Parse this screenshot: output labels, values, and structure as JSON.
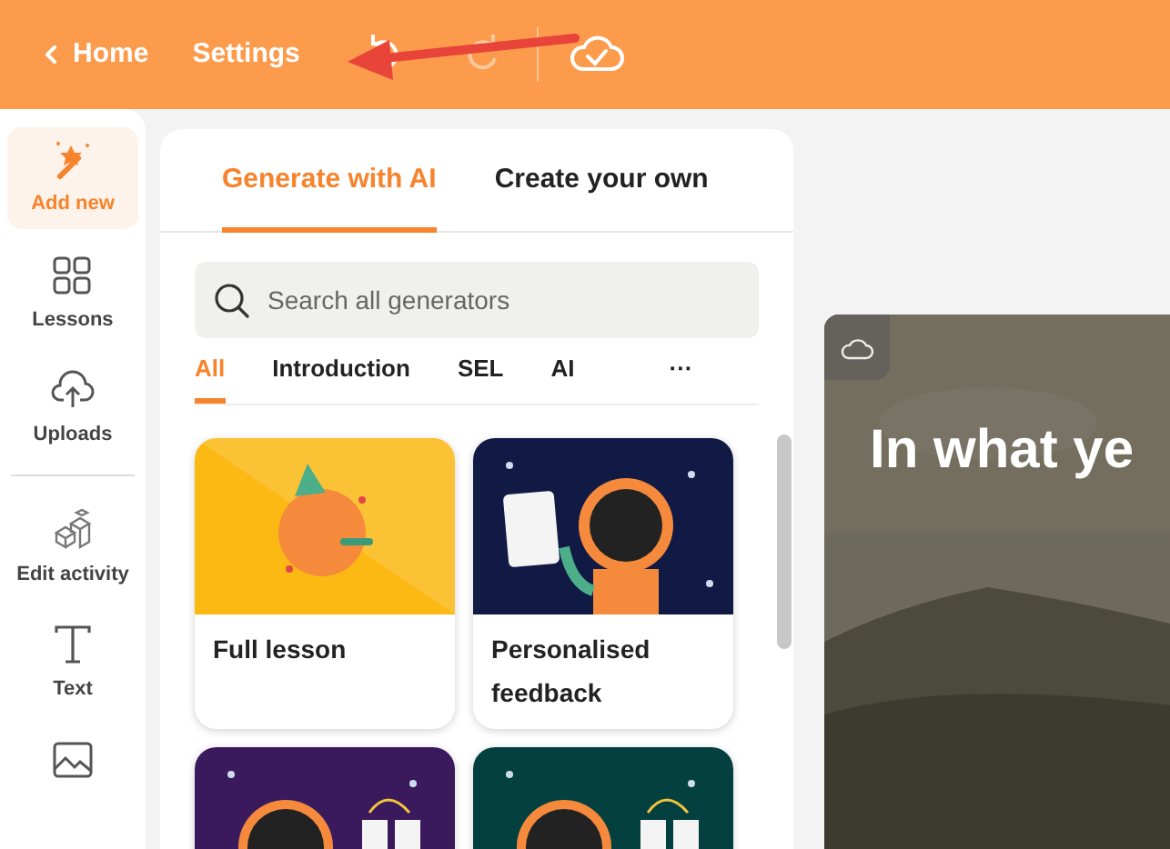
{
  "topbar": {
    "back_label": "Home",
    "settings_label": "Settings",
    "history_buttons": [
      {
        "kind": "undo",
        "disabled": false
      },
      {
        "kind": "redo",
        "disabled": true
      }
    ],
    "annotation": {
      "kind": "arrow"
    }
  },
  "sidebar": {
    "items": [
      {
        "label": "Add new",
        "selected": true
      },
      {
        "label": "Lessons",
        "selected": false
      },
      {
        "label": "Uploads",
        "selected": false
      },
      {
        "label": "Edit activity",
        "selected": false
      },
      {
        "label": "Text",
        "selected": false
      },
      {
        "selected": false
      }
    ]
  },
  "panel": {
    "tabs": [
      {
        "label": "Generate with AI",
        "selected": true
      },
      {
        "label": "Create your own",
        "selected": false
      }
    ],
    "search": {
      "placeholder": "Search all generators"
    },
    "filters": [
      {
        "label": "All",
        "selected": true
      },
      {
        "label": "Introduction",
        "selected": false
      },
      {
        "label": "SEL",
        "selected": false
      },
      {
        "label": "AI",
        "selected": false
      },
      {
        "label": "···",
        "selected": false
      }
    ],
    "cards": [
      {
        "title": "Full lesson",
        "color": "#fcb813"
      },
      {
        "title": "Personalised feedback",
        "color": "#111a45"
      },
      {
        "color": "#3a1a5c"
      },
      {
        "color": "#04403f"
      }
    ]
  },
  "slide": {
    "title": "In what ye"
  }
}
